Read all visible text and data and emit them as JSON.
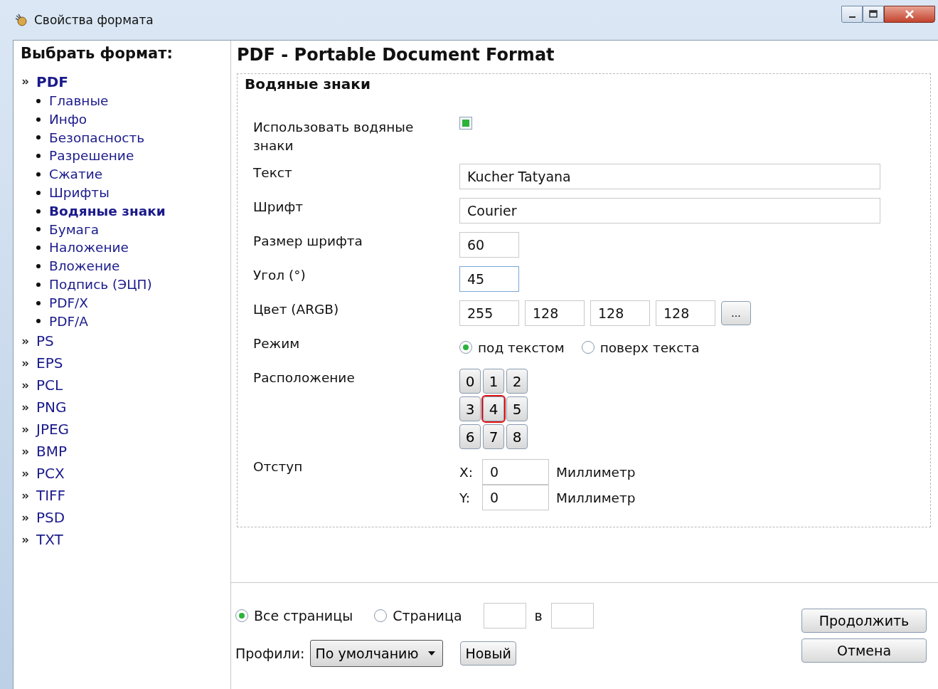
{
  "window": {
    "title": "Свойства формата"
  },
  "sidebar": {
    "heading": "Выбрать формат:",
    "formats": [
      {
        "label": "PDF",
        "selected": true,
        "children": [
          {
            "label": "Главные",
            "selected": false
          },
          {
            "label": "Инфо",
            "selected": false
          },
          {
            "label": "Безопасность",
            "selected": false
          },
          {
            "label": "Разрешение",
            "selected": false
          },
          {
            "label": "Сжатие",
            "selected": false
          },
          {
            "label": "Шрифты",
            "selected": false
          },
          {
            "label": "Водяные знаки",
            "selected": true
          },
          {
            "label": "Бумага",
            "selected": false
          },
          {
            "label": "Наложение",
            "selected": false
          },
          {
            "label": "Вложение",
            "selected": false
          },
          {
            "label": "Подпись (ЭЦП)",
            "selected": false
          },
          {
            "label": "PDF/X",
            "selected": false
          },
          {
            "label": "PDF/A",
            "selected": false
          }
        ]
      },
      {
        "label": "PS",
        "selected": false
      },
      {
        "label": "EPS",
        "selected": false
      },
      {
        "label": "PCL",
        "selected": false
      },
      {
        "label": "PNG",
        "selected": false
      },
      {
        "label": "JPEG",
        "selected": false
      },
      {
        "label": "BMP",
        "selected": false
      },
      {
        "label": "PCX",
        "selected": false
      },
      {
        "label": "TIFF",
        "selected": false
      },
      {
        "label": "PSD",
        "selected": false
      },
      {
        "label": "TXT",
        "selected": false
      }
    ]
  },
  "main": {
    "title": "PDF - Portable Document Format",
    "section": {
      "title": "Водяные знаки",
      "use": {
        "label": "Использовать водяные знаки",
        "checked": true
      },
      "text": {
        "label": "Текст",
        "value": "Kucher Tatyana"
      },
      "font": {
        "label": "Шрифт",
        "value": "Courier"
      },
      "font_size": {
        "label": "Размер шрифта",
        "value": "60"
      },
      "angle": {
        "label": "Угол (°)",
        "value": "45"
      },
      "color": {
        "label": "Цвет (ARGB)",
        "values": [
          "255",
          "128",
          "128",
          "128"
        ],
        "button": "..."
      },
      "mode": {
        "label": "Режим",
        "options": [
          {
            "label": "под текстом",
            "selected": true
          },
          {
            "label": "поверх текста",
            "selected": false
          }
        ]
      },
      "position": {
        "label": "Расположение",
        "cells": [
          {
            "label": "0",
            "selected": false
          },
          {
            "label": "1",
            "selected": false
          },
          {
            "label": "2",
            "selected": false
          },
          {
            "label": "3",
            "selected": false
          },
          {
            "label": "4",
            "selected": true
          },
          {
            "label": "5",
            "selected": false
          },
          {
            "label": "6",
            "selected": false
          },
          {
            "label": "7",
            "selected": false
          },
          {
            "label": "8",
            "selected": false
          }
        ]
      },
      "offset": {
        "label": "Отступ",
        "rows": [
          {
            "axis": "X:",
            "value": "0",
            "unit": "Миллиметр"
          },
          {
            "axis": "Y:",
            "value": "0",
            "unit": "Миллиметр"
          }
        ]
      }
    }
  },
  "footer": {
    "pages": [
      {
        "label": "Все страницы",
        "selected": true
      },
      {
        "label": "Страница",
        "selected": false
      }
    ],
    "range_separator": "в",
    "profiles": {
      "label": "Профили:",
      "value": "По умолчанию"
    },
    "new_button": "Новый",
    "buttons": [
      "Продолжить",
      "Отмена"
    ]
  }
}
